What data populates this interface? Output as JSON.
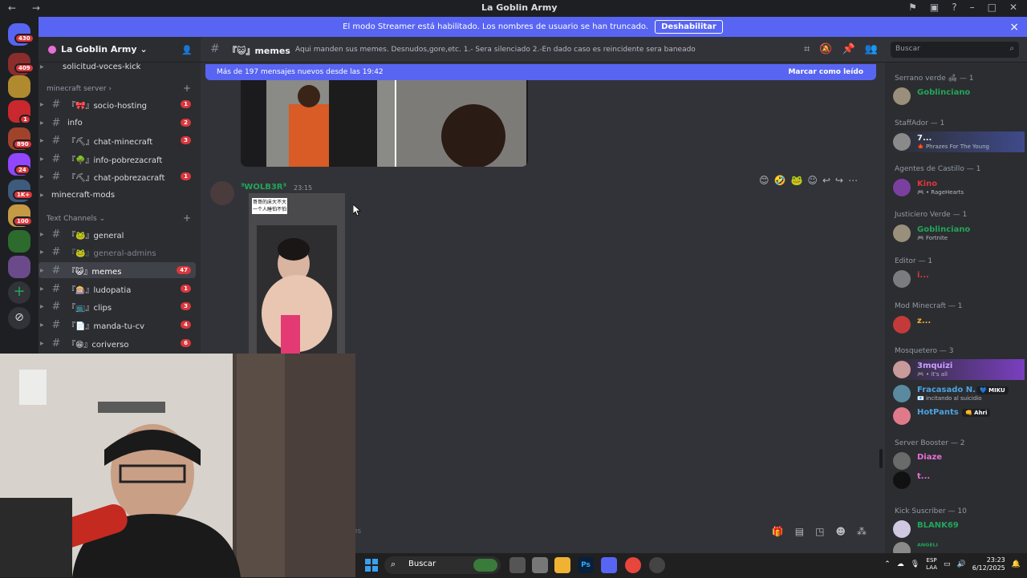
{
  "window": {
    "title": "La Goblin Army",
    "nav_label": "← →"
  },
  "banner": {
    "text": "El modo Streamer está habilitado. Los nombres de usuario se han truncado.",
    "button": "Deshabilitar",
    "close": "×"
  },
  "guilds": [
    {
      "badge": "430"
    },
    {
      "badge": "409"
    },
    {
      "badge": ""
    },
    {
      "badge": "1"
    },
    {
      "badge": "890"
    },
    {
      "badge": "24"
    },
    {
      "badge": "1K+"
    },
    {
      "badge": "100"
    },
    {
      "badge": ""
    },
    {
      "badge": ""
    }
  ],
  "server": {
    "name": "La Goblin Army",
    "chevron": "⌄"
  },
  "channels_top": {
    "partial": "solicitud-voces-kick"
  },
  "categories": [
    {
      "label": "minecraft server",
      "plus": "+"
    },
    {
      "label": "Text Channels",
      "plus": "+"
    }
  ],
  "channels_mc": [
    {
      "name": "『🎀』socio-hosting",
      "count": "1"
    },
    {
      "name": "info",
      "count": "2"
    },
    {
      "name": "『⛏』chat-minecraft",
      "count": "3"
    },
    {
      "name": "『🌳』info-pobrezacraft",
      "count": ""
    },
    {
      "name": "『⛏』chat-pobrezacraft",
      "count": "1"
    },
    {
      "name": "minecraft-mods",
      "count": ""
    }
  ],
  "channels_text": [
    {
      "name": "『🐸』general",
      "count": ""
    },
    {
      "name": "『🐸』general-admins",
      "count": ""
    },
    {
      "name": "『😺』memes",
      "count": "47"
    },
    {
      "name": "『🎰』ludopatia",
      "count": "1"
    },
    {
      "name": "『📺』clips",
      "count": "3"
    },
    {
      "name": "『📄』manda-tu-cv",
      "count": "4"
    },
    {
      "name": "『😁』coriverso",
      "count": "6"
    }
  ],
  "topbar": {
    "hash": "#",
    "channel": "『😺』memes",
    "topic": "Aqui manden sus memes. Desnudos,gore,etc. 1.- Sera silenciado 2.-En dado caso es reincidente sera baneado",
    "search_placeholder": "Buscar"
  },
  "newbar": {
    "text": "Más de 197 mensajes nuevos desde las 19:42",
    "mark": "Marcar como leído"
  },
  "message": {
    "author": "ᴲWOLB3Rᴲ",
    "time": "23:15",
    "caption": "哥哥的床大不大\n一个人睡怕不怕"
  },
  "composer": {
    "hint": "es"
  },
  "members": [
    {
      "group": "Serrano verde 🛋 — 1"
    },
    {
      "name": "Goblinciano",
      "status": "",
      "color": "#23a559"
    },
    {
      "group": "StaffAdor — 1"
    },
    {
      "name": "7...",
      "status": "🍁 Phrazes For The Young",
      "color": "#f2f3f5"
    },
    {
      "group": "Agentes de Castillo — 1"
    },
    {
      "name": "Kino",
      "status": "🎮 • RageHearts",
      "color": "#da373c"
    },
    {
      "group": "Justiciero Verde — 1"
    },
    {
      "name": "Goblinciano",
      "status": "🎮 Fortnite",
      "color": "#23a559"
    },
    {
      "group": "Editor — 1"
    },
    {
      "name": "i...",
      "status": "",
      "color": "#da373c"
    },
    {
      "group": "Mod Minecraft — 1"
    },
    {
      "name": "z...",
      "status": "",
      "color": "#f0b232"
    },
    {
      "group": "Mosquetero — 3"
    },
    {
      "name": "3mquizi",
      "status": "🎮 • it's all",
      "color": "#c9a0ff"
    },
    {
      "name": "Fracasado N...",
      "status": "📧 incitando al suicidio",
      "color": "#4ea3e0",
      "tag": "💙 MIKU"
    },
    {
      "name": "HotPants",
      "status": "",
      "color": "#4ea3e0",
      "tag": "👊 Ahri"
    },
    {
      "group": "Server Booster — 2"
    },
    {
      "name": "Diaze",
      "status": "",
      "color": "#e86fd6"
    },
    {
      "name": "t...",
      "status": "",
      "color": "#e86fd6"
    },
    {
      "group": "Kick Suscriber — 10"
    },
    {
      "name": "BLANK69",
      "status": "",
      "color": "#23a559"
    },
    {
      "name": "ᴬᴺᴳᴱᴸᴵ",
      "status": "",
      "color": "#23a559"
    }
  ],
  "taskbar": {
    "search": "Buscar",
    "lang1": "ESP",
    "lang2": "LAA",
    "time": "23:23",
    "date": "6/12/2025"
  },
  "colors": {
    "accent": "#5865f2",
    "danger": "#da373c",
    "online": "#23a559"
  }
}
